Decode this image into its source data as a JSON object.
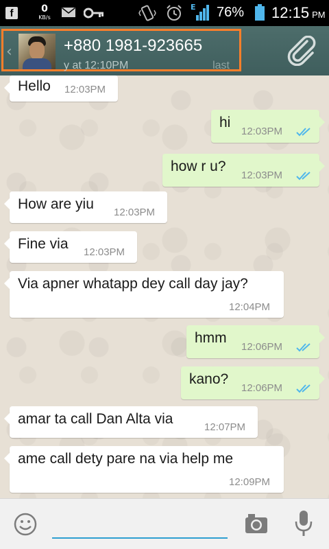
{
  "status_bar": {
    "facebook_glyph": "f",
    "data_speed": "0",
    "data_unit": "KB/s",
    "network_type": "E",
    "battery_percent": "76%",
    "time": "12:15",
    "ampm": "PM",
    "icons": [
      "facebook-icon",
      "mail-icon",
      "key-icon",
      "vibrate-icon",
      "alarm-icon",
      "signal-icon",
      "battery-icon"
    ]
  },
  "header": {
    "back_glyph": "‹",
    "contact_name": "+880 1981-923665",
    "last_seen_start": "y at 12:10PM",
    "last_seen_end": "last",
    "highlight_color": "#ff7f2a",
    "bar_color": "#4a6a6a",
    "attach_icon": "paperclip-icon"
  },
  "messages": [
    {
      "direction": "in",
      "text": "Hello",
      "time": "12:03PM"
    },
    {
      "direction": "out",
      "text": "hi",
      "time": "12:03PM",
      "read_ticks": true
    },
    {
      "direction": "out",
      "text": "how r u?",
      "time": "12:03PM",
      "read_ticks": true
    },
    {
      "direction": "in",
      "text": "How are yiu",
      "time": "12:03PM"
    },
    {
      "direction": "in",
      "text": "Fine via",
      "time": "12:03PM"
    },
    {
      "direction": "in",
      "text": "Via apner whatapp dey call day jay?",
      "time": "12:04PM"
    },
    {
      "direction": "out",
      "text": "hmm",
      "time": "12:06PM",
      "read_ticks": true
    },
    {
      "direction": "out",
      "text": "kano?",
      "time": "12:06PM",
      "read_ticks": true
    },
    {
      "direction": "in",
      "text": "amar ta call Dan Alta via",
      "time": "12:07PM"
    },
    {
      "direction": "in",
      "text": "ame call dety pare na via help me",
      "time": "12:09PM"
    }
  ],
  "compose": {
    "input_value": "",
    "input_placeholder": "",
    "icons": [
      "emoji-icon",
      "camera-icon",
      "microphone-icon"
    ]
  },
  "colors": {
    "incoming_bubble": "#ffffff",
    "outgoing_bubble": "#e1f7cb",
    "read_tick": "#4fb6ec",
    "input_underline": "#2e9fd1"
  }
}
